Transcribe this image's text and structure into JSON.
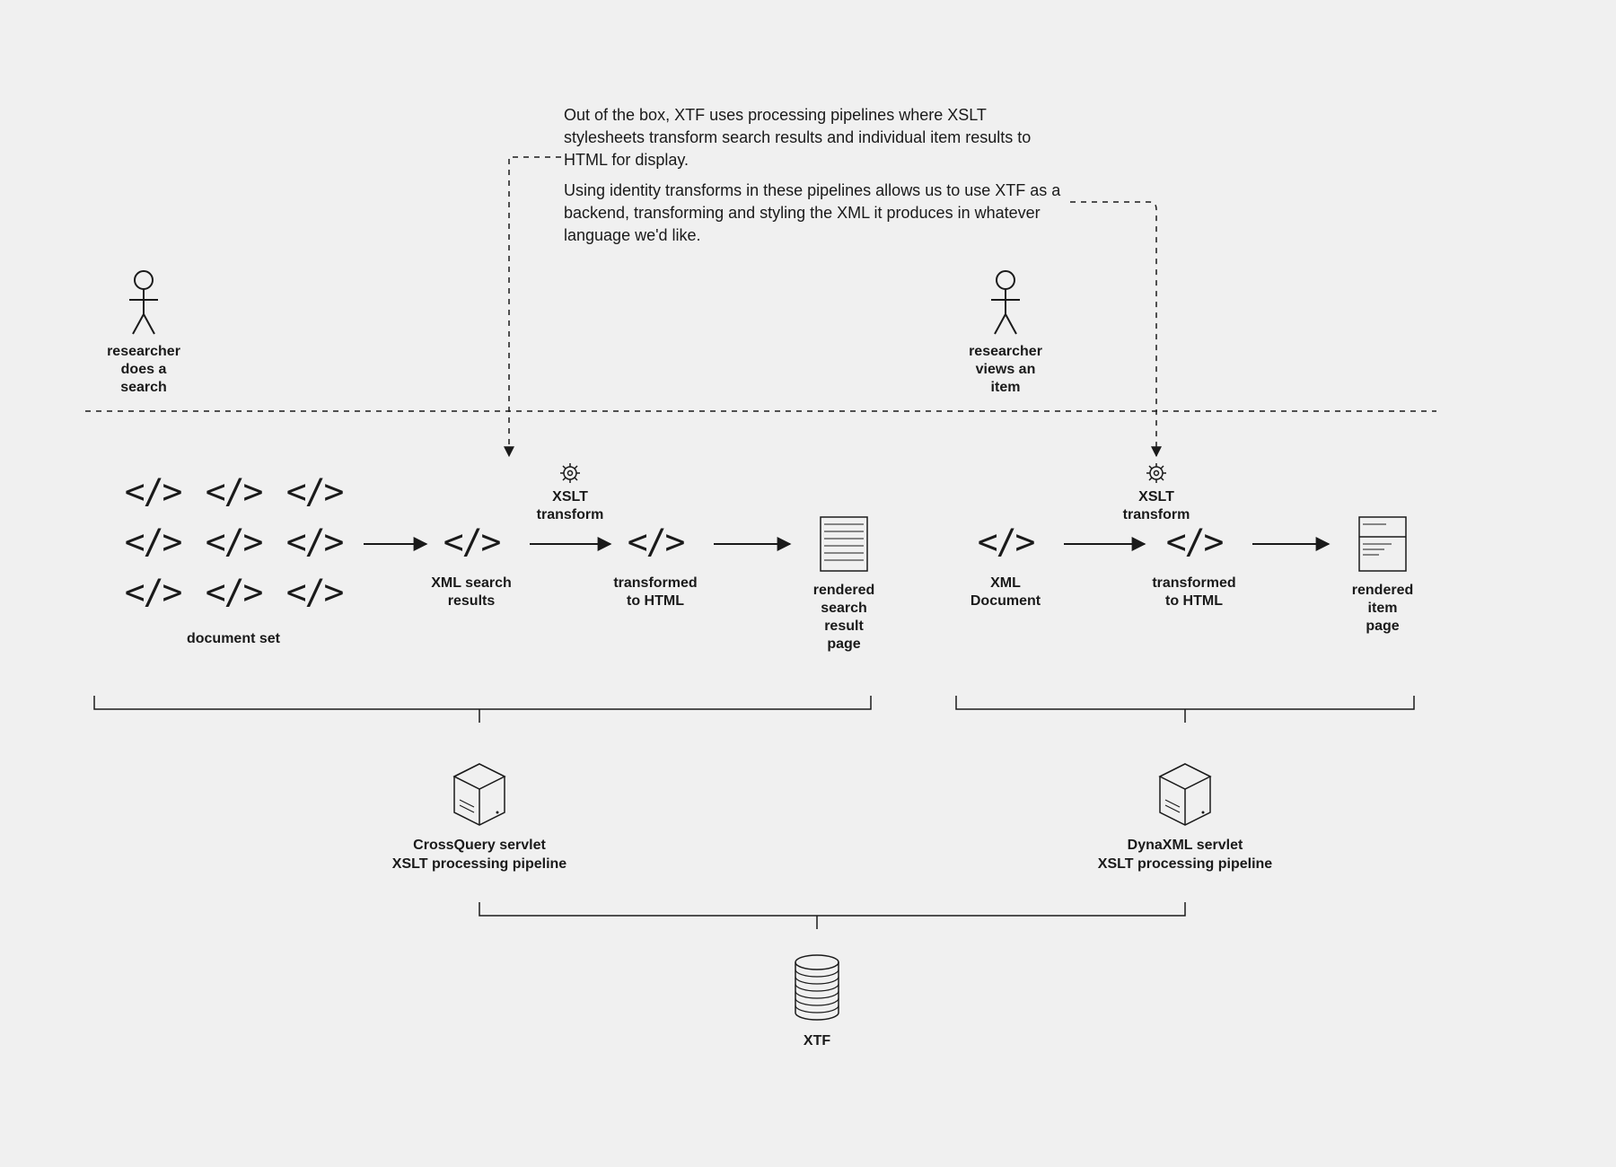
{
  "description": {
    "p1": "Out of the box, XTF uses processing pipelines where XSLT stylesheets transform search results and individual item results to HTML for display.",
    "p2": "Using identity transforms in these pipelines allows us to use XTF as a backend, transforming and styling the XML it produces in whatever language we'd like."
  },
  "actors": {
    "left": "researcher\ndoes a\nsearch",
    "right": "researcher\nviews an\nitem"
  },
  "pipeline_left": {
    "documentSet": "document set",
    "xmlResults": "XML search\nresults",
    "xslt": "XSLT\ntransform",
    "transformed": "transformed\nto HTML",
    "rendered": "rendered\nsearch\nresult\npage"
  },
  "pipeline_right": {
    "xmlDoc": "XML\nDocument",
    "xslt": "XSLT\ntransform",
    "transformed": "transformed\nto HTML",
    "rendered": "rendered\nitem\npage"
  },
  "servlets": {
    "left": "CrossQuery servlet\nXSLT processing pipeline",
    "right": "DynaXML servlet\nXSLT processing pipeline"
  },
  "xtf": "XTF"
}
